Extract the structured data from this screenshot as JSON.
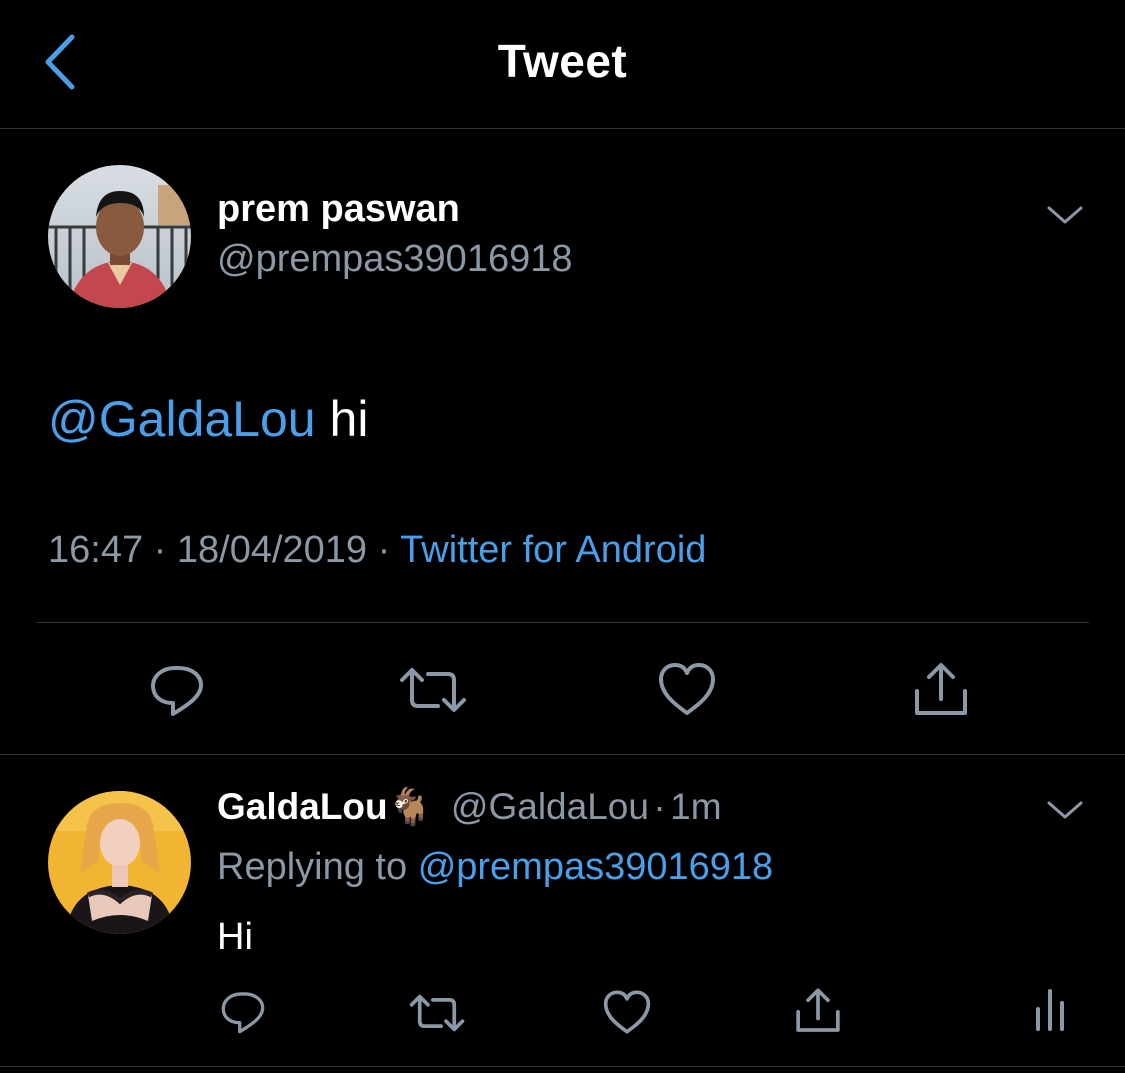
{
  "header": {
    "title": "Tweet"
  },
  "colors": {
    "background": "#000000",
    "accent": "#4a9fe8",
    "secondary_text": "#8b98a5",
    "divider": "#2f3336"
  },
  "tweet": {
    "display_name": "prem paswan",
    "handle": "@prempas39016918",
    "mention": "@GaldaLou",
    "text": "hi",
    "time": "16:47",
    "separator": "·",
    "date": "18/04/2019",
    "source": "Twitter for Android",
    "actions": [
      "reply-icon",
      "retweet-icon",
      "like-icon",
      "share-icon"
    ]
  },
  "reply": {
    "display_name": "GaldaLou",
    "emoji": "🐐",
    "handle": "@GaldaLou",
    "separator": "·",
    "time": "1m",
    "replying_prefix": "Replying to",
    "replying_handle": "@prempas39016918",
    "text": "Hi",
    "actions": [
      "reply-icon",
      "retweet-icon",
      "like-icon",
      "share-icon",
      "analytics-icon"
    ]
  }
}
